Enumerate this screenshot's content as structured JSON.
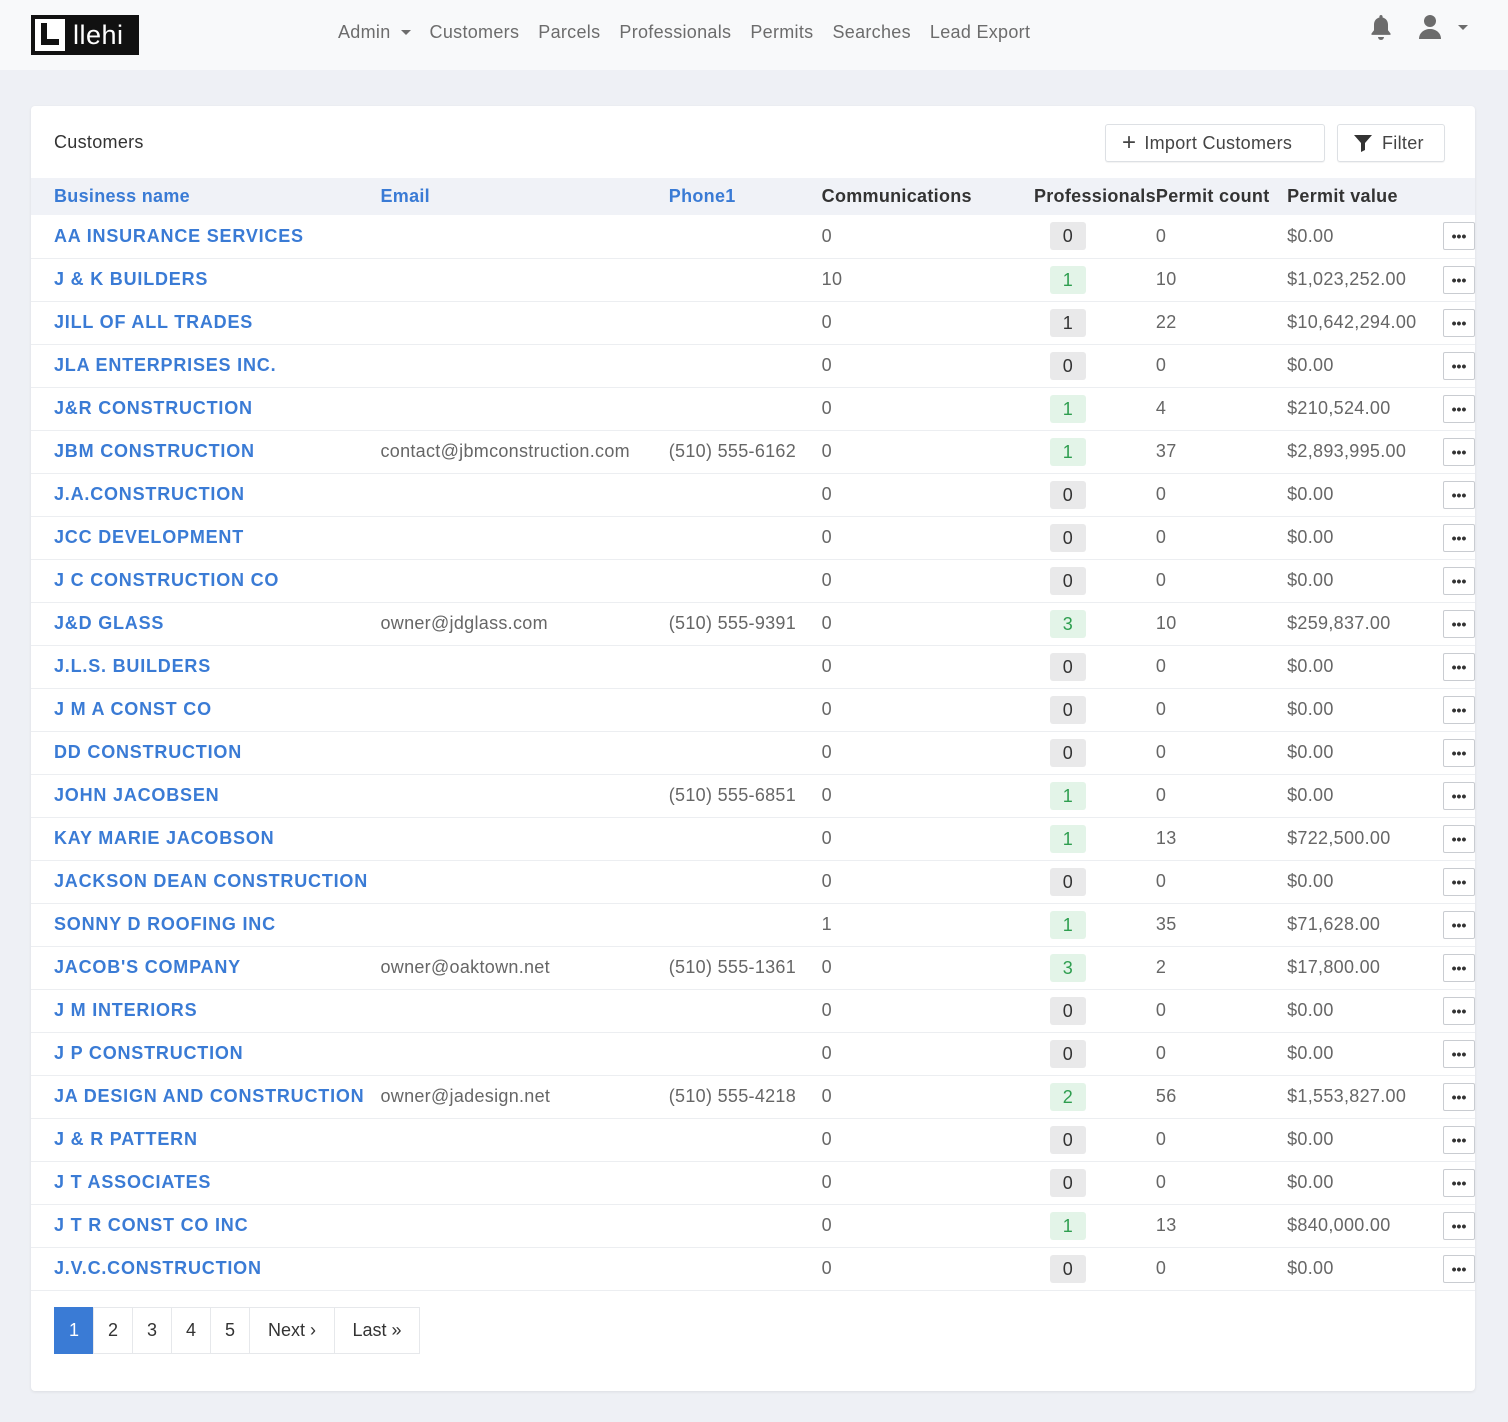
{
  "app": {
    "logo_text": "llehi"
  },
  "nav": {
    "items": [
      {
        "label": "Admin",
        "dropdown": true
      },
      {
        "label": "Customers"
      },
      {
        "label": "Parcels"
      },
      {
        "label": "Professionals"
      },
      {
        "label": "Permits"
      },
      {
        "label": "Searches"
      },
      {
        "label": "Lead Export"
      }
    ]
  },
  "card": {
    "title": "Customers",
    "import_label": "Import Customers",
    "filter_label": "Filter"
  },
  "table": {
    "headers": {
      "business_name": "Business name",
      "email": "Email",
      "phone": "Phone1",
      "communications": "Communications",
      "professionals": "Professionals",
      "permit_count": "Permit count",
      "permit_value": "Permit value"
    },
    "rows": [
      {
        "name": "AA INSURANCE SERVICES",
        "email": "",
        "phone": "",
        "comm": "0",
        "pros": "0",
        "count": "0",
        "value": "$0.00"
      },
      {
        "name": "J & K BUILDERS",
        "email": "",
        "phone": "",
        "comm": "10",
        "pros": "1",
        "count": "10",
        "value": "$1,023,252.00"
      },
      {
        "name": "JILL OF ALL TRADES",
        "email": "",
        "phone": "",
        "comm": "0",
        "pros": "1",
        "count": "22",
        "value": "$10,642,294.00"
      },
      {
        "name": "JLA ENTERPRISES INC.",
        "email": "",
        "phone": "",
        "comm": "0",
        "pros": "0",
        "count": "0",
        "value": "$0.00"
      },
      {
        "name": "J&R CONSTRUCTION",
        "email": "",
        "phone": "",
        "comm": "0",
        "pros": "1",
        "count": "4",
        "value": "$210,524.00"
      },
      {
        "name": "JBM CONSTRUCTION",
        "email": "contact@jbmconstruction.com",
        "phone": "(510) 555-6162",
        "comm": "0",
        "pros": "1",
        "count": "37",
        "value": "$2,893,995.00"
      },
      {
        "name": "J.A.CONSTRUCTION",
        "email": "",
        "phone": "",
        "comm": "0",
        "pros": "0",
        "count": "0",
        "value": "$0.00"
      },
      {
        "name": "JCC DEVELOPMENT",
        "email": "",
        "phone": "",
        "comm": "0",
        "pros": "0",
        "count": "0",
        "value": "$0.00"
      },
      {
        "name": "J C CONSTRUCTION CO",
        "email": "",
        "phone": "",
        "comm": "0",
        "pros": "0",
        "count": "0",
        "value": "$0.00"
      },
      {
        "name": "J&D GLASS",
        "email": "owner@jdglass.com",
        "phone": "(510) 555-9391",
        "comm": "0",
        "pros": "3",
        "count": "10",
        "value": "$259,837.00"
      },
      {
        "name": "J.L.S. BUILDERS",
        "email": "",
        "phone": "",
        "comm": "0",
        "pros": "0",
        "count": "0",
        "value": "$0.00"
      },
      {
        "name": "J M A CONST CO",
        "email": "",
        "phone": "",
        "comm": "0",
        "pros": "0",
        "count": "0",
        "value": "$0.00"
      },
      {
        "name": "DD CONSTRUCTION",
        "email": "",
        "phone": "",
        "comm": "0",
        "pros": "0",
        "count": "0",
        "value": "$0.00"
      },
      {
        "name": "JOHN JACOBSEN",
        "email": "",
        "phone": "(510) 555-6851",
        "comm": "0",
        "pros": "1",
        "count": "0",
        "value": "$0.00"
      },
      {
        "name": "KAY MARIE JACOBSON",
        "email": "",
        "phone": "",
        "comm": "0",
        "pros": "1",
        "count": "13",
        "value": "$722,500.00"
      },
      {
        "name": "JACKSON DEAN CONSTRUCTION",
        "email": "",
        "phone": "",
        "comm": "0",
        "pros": "0",
        "count": "0",
        "value": "$0.00"
      },
      {
        "name": "SONNY D ROOFING INC",
        "email": "",
        "phone": "",
        "comm": "1",
        "pros": "1",
        "count": "35",
        "value": "$71,628.00"
      },
      {
        "name": "JACOB'S COMPANY",
        "email": "owner@oaktown.net",
        "phone": "(510) 555-1361",
        "comm": "0",
        "pros": "3",
        "count": "2",
        "value": "$17,800.00"
      },
      {
        "name": "J M INTERIORS",
        "email": "",
        "phone": "",
        "comm": "0",
        "pros": "0",
        "count": "0",
        "value": "$0.00"
      },
      {
        "name": "J P CONSTRUCTION",
        "email": "",
        "phone": "",
        "comm": "0",
        "pros": "0",
        "count": "0",
        "value": "$0.00"
      },
      {
        "name": "JA DESIGN AND CONSTRUCTION",
        "email": "owner@jadesign.net",
        "phone": "(510) 555-4218",
        "comm": "0",
        "pros": "2",
        "count": "56",
        "value": "$1,553,827.00"
      },
      {
        "name": "J & R PATTERN",
        "email": "",
        "phone": "",
        "comm": "0",
        "pros": "0",
        "count": "0",
        "value": "$0.00"
      },
      {
        "name": "J T ASSOCIATES",
        "email": "",
        "phone": "",
        "comm": "0",
        "pros": "0",
        "count": "0",
        "value": "$0.00"
      },
      {
        "name": "J T R CONST CO INC",
        "email": "",
        "phone": "",
        "comm": "0",
        "pros": "1",
        "count": "13",
        "value": "$840,000.00"
      },
      {
        "name": "J.V.C.CONSTRUCTION",
        "email": "",
        "phone": "",
        "comm": "0",
        "pros": "0",
        "count": "0",
        "value": "$0.00"
      }
    ],
    "pros_badge_style": [
      "zero",
      "one",
      "gray1",
      "zero",
      "one",
      "one",
      "zero",
      "zero",
      "zero",
      "one",
      "zero",
      "zero",
      "zero",
      "one",
      "one",
      "zero",
      "one",
      "one",
      "zero",
      "zero",
      "one",
      "zero",
      "zero",
      "one",
      "zero"
    ],
    "row_action_icon": "ellipsis-icon"
  },
  "pagination": {
    "pages": [
      {
        "label": "1",
        "active": true
      },
      {
        "label": "2"
      },
      {
        "label": "3"
      },
      {
        "label": "4"
      },
      {
        "label": "5"
      },
      {
        "label": "Next ›"
      },
      {
        "label": "Last »"
      }
    ]
  },
  "colors": {
    "accent": "#3a7bd5",
    "badge_green_bg": "#e3f4e8",
    "badge_green_fg": "#2e9e4f",
    "badge_gray_bg": "#e9e9ea"
  },
  "icons": {
    "notifications": "bell-icon",
    "user": "user-icon",
    "import": "plus-icon",
    "filter": "funnel-icon"
  }
}
